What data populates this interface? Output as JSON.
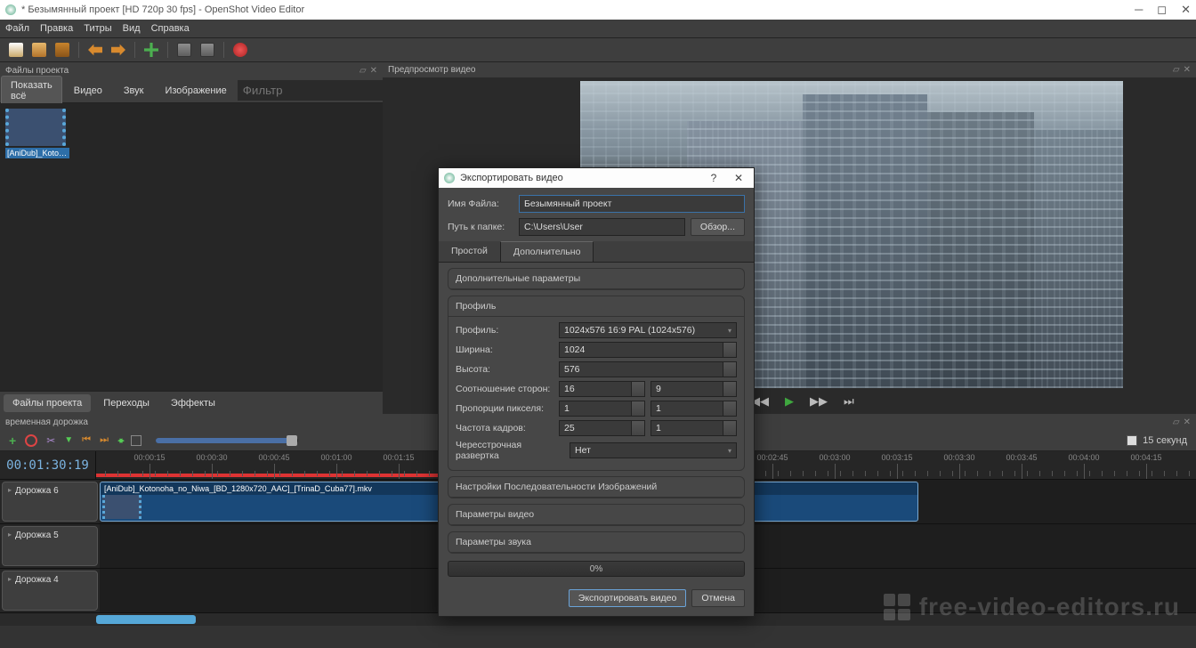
{
  "window": {
    "title": "* Безымянный проект [HD 720p 30 fps] - OpenShot Video Editor"
  },
  "menus": [
    "Файл",
    "Правка",
    "Титры",
    "Вид",
    "Справка"
  ],
  "panels": {
    "files": "Файлы проекта",
    "preview": "Предпросмотр видео",
    "timeline": "временная дорожка"
  },
  "filter_tabs": {
    "all": "Показать всё",
    "video": "Видео",
    "audio": "Звук",
    "image": "Изображение",
    "placeholder": "Фильтр"
  },
  "project_file": {
    "label": "[AniDub]_Koton..."
  },
  "bottom_tabs": {
    "files": "Файлы проекта",
    "transitions": "Переходы",
    "effects": "Эффекты"
  },
  "timecode": "00:01:30:19",
  "zoom_label": "15 секунд",
  "ruler_labels": [
    "00:00:15",
    "00:00:30",
    "00:00:45",
    "00:01:00",
    "00:01:15",
    "00:02:45",
    "00:03:00",
    "00:03:15",
    "00:03:30",
    "00:03:45",
    "00:04:00",
    "00:04:15"
  ],
  "tracks": {
    "t6": "Дорожка 6",
    "t5": "Дорожка 5",
    "t4": "Дорожка 4"
  },
  "clip": {
    "label": "[AniDub]_Kotonoha_no_Niwa_[BD_1280x720_AAC]_[TrinaD_Cuba77].mkv"
  },
  "watermark": "free-video-editors.ru",
  "dialog": {
    "title": "Экспортировать видео",
    "filename_label": "Имя Файла:",
    "filename_value": "Безымянный проект",
    "path_label": "Путь к папке:",
    "path_value": "C:\\Users\\User",
    "browse": "Обзор...",
    "tab_simple": "Простой",
    "tab_advanced": "Дополнительно",
    "section_extra": "Дополнительные параметры",
    "section_profile": "Профиль",
    "profile_label": "Профиль:",
    "profile_value": "1024x576 16:9 PAL (1024x576)",
    "width_label": "Ширина:",
    "width_value": "1024",
    "height_label": "Высота:",
    "height_value": "576",
    "aspect_label": "Соотношение сторон:",
    "aspect_a": "16",
    "aspect_b": "9",
    "par_label": "Пропорции пикселя:",
    "par_a": "1",
    "par_b": "1",
    "fps_label": "Частота кадров:",
    "fps_a": "25",
    "fps_b": "1",
    "interlace_label": "Чересстрочная развертка",
    "interlace_value": "Нет",
    "section_imgseq": "Настройки Последовательности Изображений",
    "section_video": "Параметры видео",
    "section_audio": "Параметры звука",
    "progress": "0%",
    "export_btn": "Экспортировать видео",
    "cancel_btn": "Отмена"
  }
}
